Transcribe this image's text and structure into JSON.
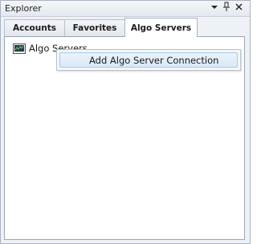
{
  "window": {
    "title": "Explorer"
  },
  "titlebar_buttons": {
    "dropdown": "▾",
    "pin": "ᵖ",
    "close": "✕"
  },
  "tabs": [
    {
      "label": "Accounts",
      "active": false
    },
    {
      "label": "Favorites",
      "active": false
    },
    {
      "label": "Algo Servers",
      "active": true
    }
  ],
  "tree": {
    "items": [
      {
        "label": "Algo Servers",
        "icon": "server-icon"
      }
    ]
  },
  "context_menu": {
    "items": [
      {
        "label": "Add Algo Server Connection"
      }
    ]
  },
  "colors": {
    "accent_highlight": "#d9e9f7",
    "border": "#a9b4c2"
  }
}
